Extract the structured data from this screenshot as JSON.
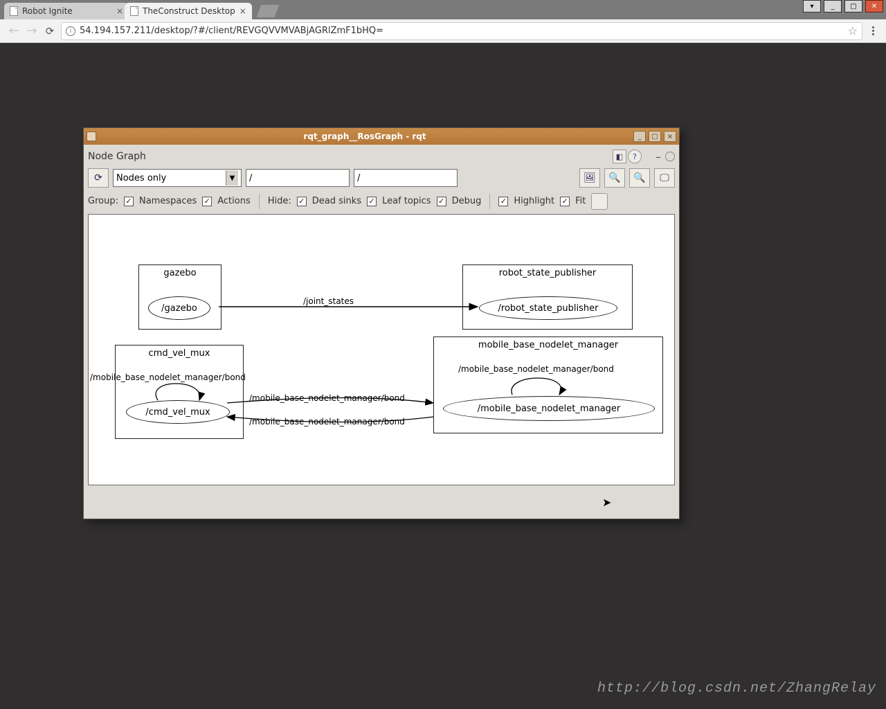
{
  "browser": {
    "tabs": [
      {
        "label": "Robot Ignite"
      },
      {
        "label": "TheConstruct Desktop"
      }
    ],
    "url": "54.194.157.211/desktop/?#/client/REVGQVVMVABjAGRlZmF1bHQ="
  },
  "rqt": {
    "title": "rqt_graph__RosGraph - rqt",
    "panel_label": "Node Graph",
    "select_value": "Nodes only",
    "filter1": "/",
    "filter2": "/",
    "group_label": "Group:",
    "hide_label": "Hide:",
    "checks": {
      "namespaces": "Namespaces",
      "actions": "Actions",
      "dead_sinks": "Dead sinks",
      "leaf_topics": "Leaf topics",
      "debug": "Debug",
      "highlight": "Highlight",
      "fit": "Fit"
    },
    "graph": {
      "nodes": {
        "gazebo_box": "gazebo",
        "gazebo_node": "/gazebo",
        "rsp_box": "robot_state_publisher",
        "rsp_node": "/robot_state_publisher",
        "cmd_box": "cmd_vel_mux",
        "cmd_node": "/cmd_vel_mux",
        "mb_box": "mobile_base_nodelet_manager",
        "mb_node": "/mobile_base_nodelet_manager"
      },
      "edges": {
        "joint_states": "/joint_states",
        "bond1": "/mobile_base_nodelet_manager/bond",
        "bond2": "/mobile_base_nodelet_manager/bond",
        "bond3": "/mobile_base_nodelet_manager/bond",
        "bond4": "/mobile_base_nodelet_manager/bond"
      }
    }
  },
  "watermark": "http://blog.csdn.net/ZhangRelay"
}
